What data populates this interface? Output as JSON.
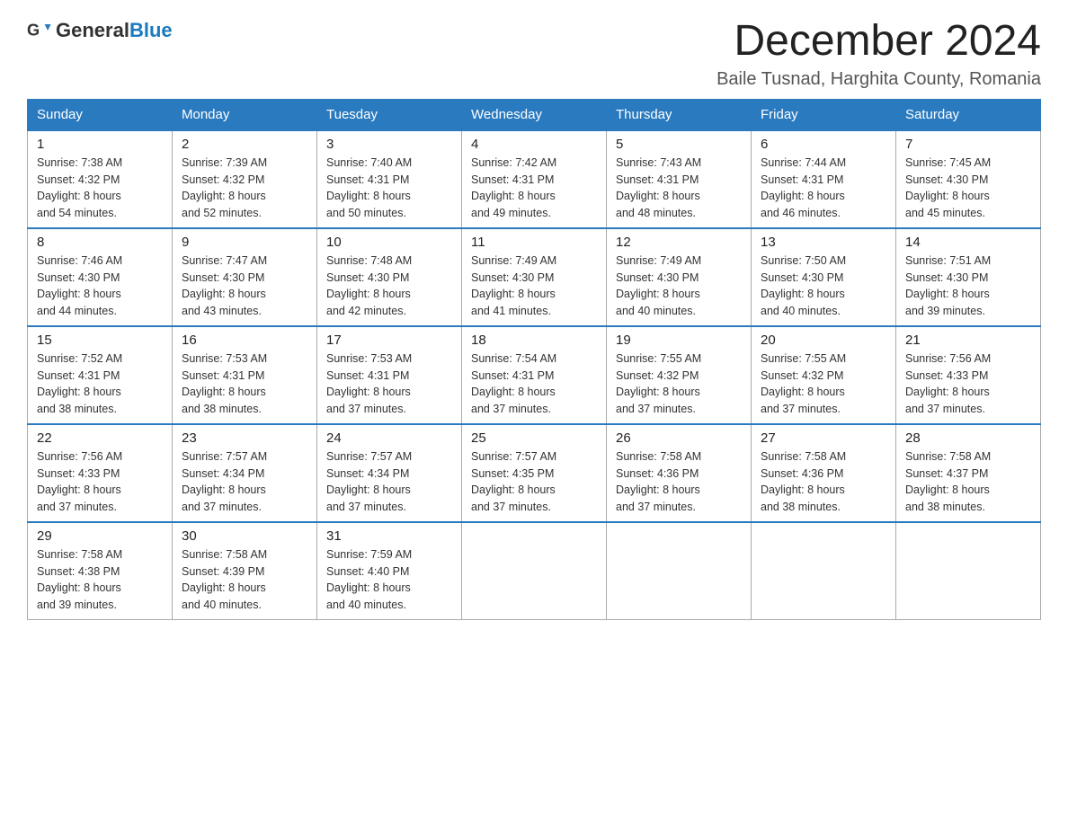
{
  "header": {
    "logo": {
      "text_general": "General",
      "text_blue": "Blue",
      "alt": "GeneralBlue logo"
    },
    "title": "December 2024",
    "subtitle": "Baile Tusnad, Harghita County, Romania"
  },
  "calendar": {
    "days_of_week": [
      "Sunday",
      "Monday",
      "Tuesday",
      "Wednesday",
      "Thursday",
      "Friday",
      "Saturday"
    ],
    "weeks": [
      [
        {
          "day": "1",
          "sunrise": "7:38 AM",
          "sunset": "4:32 PM",
          "daylight": "8 hours and 54 minutes."
        },
        {
          "day": "2",
          "sunrise": "7:39 AM",
          "sunset": "4:32 PM",
          "daylight": "8 hours and 52 minutes."
        },
        {
          "day": "3",
          "sunrise": "7:40 AM",
          "sunset": "4:31 PM",
          "daylight": "8 hours and 50 minutes."
        },
        {
          "day": "4",
          "sunrise": "7:42 AM",
          "sunset": "4:31 PM",
          "daylight": "8 hours and 49 minutes."
        },
        {
          "day": "5",
          "sunrise": "7:43 AM",
          "sunset": "4:31 PM",
          "daylight": "8 hours and 48 minutes."
        },
        {
          "day": "6",
          "sunrise": "7:44 AM",
          "sunset": "4:31 PM",
          "daylight": "8 hours and 46 minutes."
        },
        {
          "day": "7",
          "sunrise": "7:45 AM",
          "sunset": "4:30 PM",
          "daylight": "8 hours and 45 minutes."
        }
      ],
      [
        {
          "day": "8",
          "sunrise": "7:46 AM",
          "sunset": "4:30 PM",
          "daylight": "8 hours and 44 minutes."
        },
        {
          "day": "9",
          "sunrise": "7:47 AM",
          "sunset": "4:30 PM",
          "daylight": "8 hours and 43 minutes."
        },
        {
          "day": "10",
          "sunrise": "7:48 AM",
          "sunset": "4:30 PM",
          "daylight": "8 hours and 42 minutes."
        },
        {
          "day": "11",
          "sunrise": "7:49 AM",
          "sunset": "4:30 PM",
          "daylight": "8 hours and 41 minutes."
        },
        {
          "day": "12",
          "sunrise": "7:49 AM",
          "sunset": "4:30 PM",
          "daylight": "8 hours and 40 minutes."
        },
        {
          "day": "13",
          "sunrise": "7:50 AM",
          "sunset": "4:30 PM",
          "daylight": "8 hours and 40 minutes."
        },
        {
          "day": "14",
          "sunrise": "7:51 AM",
          "sunset": "4:30 PM",
          "daylight": "8 hours and 39 minutes."
        }
      ],
      [
        {
          "day": "15",
          "sunrise": "7:52 AM",
          "sunset": "4:31 PM",
          "daylight": "8 hours and 38 minutes."
        },
        {
          "day": "16",
          "sunrise": "7:53 AM",
          "sunset": "4:31 PM",
          "daylight": "8 hours and 38 minutes."
        },
        {
          "day": "17",
          "sunrise": "7:53 AM",
          "sunset": "4:31 PM",
          "daylight": "8 hours and 37 minutes."
        },
        {
          "day": "18",
          "sunrise": "7:54 AM",
          "sunset": "4:31 PM",
          "daylight": "8 hours and 37 minutes."
        },
        {
          "day": "19",
          "sunrise": "7:55 AM",
          "sunset": "4:32 PM",
          "daylight": "8 hours and 37 minutes."
        },
        {
          "day": "20",
          "sunrise": "7:55 AM",
          "sunset": "4:32 PM",
          "daylight": "8 hours and 37 minutes."
        },
        {
          "day": "21",
          "sunrise": "7:56 AM",
          "sunset": "4:33 PM",
          "daylight": "8 hours and 37 minutes."
        }
      ],
      [
        {
          "day": "22",
          "sunrise": "7:56 AM",
          "sunset": "4:33 PM",
          "daylight": "8 hours and 37 minutes."
        },
        {
          "day": "23",
          "sunrise": "7:57 AM",
          "sunset": "4:34 PM",
          "daylight": "8 hours and 37 minutes."
        },
        {
          "day": "24",
          "sunrise": "7:57 AM",
          "sunset": "4:34 PM",
          "daylight": "8 hours and 37 minutes."
        },
        {
          "day": "25",
          "sunrise": "7:57 AM",
          "sunset": "4:35 PM",
          "daylight": "8 hours and 37 minutes."
        },
        {
          "day": "26",
          "sunrise": "7:58 AM",
          "sunset": "4:36 PM",
          "daylight": "8 hours and 37 minutes."
        },
        {
          "day": "27",
          "sunrise": "7:58 AM",
          "sunset": "4:36 PM",
          "daylight": "8 hours and 38 minutes."
        },
        {
          "day": "28",
          "sunrise": "7:58 AM",
          "sunset": "4:37 PM",
          "daylight": "8 hours and 38 minutes."
        }
      ],
      [
        {
          "day": "29",
          "sunrise": "7:58 AM",
          "sunset": "4:38 PM",
          "daylight": "8 hours and 39 minutes."
        },
        {
          "day": "30",
          "sunrise": "7:58 AM",
          "sunset": "4:39 PM",
          "daylight": "8 hours and 40 minutes."
        },
        {
          "day": "31",
          "sunrise": "7:59 AM",
          "sunset": "4:40 PM",
          "daylight": "8 hours and 40 minutes."
        },
        null,
        null,
        null,
        null
      ]
    ]
  },
  "labels": {
    "sunrise": "Sunrise:",
    "sunset": "Sunset:",
    "daylight": "Daylight:"
  }
}
